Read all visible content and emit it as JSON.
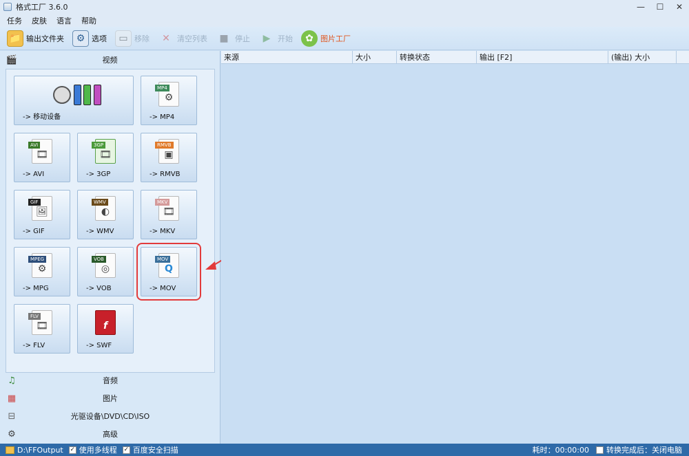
{
  "window": {
    "title": "格式工厂 3.6.0"
  },
  "menu": [
    "任务",
    "皮肤",
    "语言",
    "帮助"
  ],
  "toolbar": [
    {
      "label": "输出文件夹",
      "icon": "folder-icon",
      "disabled": false,
      "accent": false
    },
    {
      "label": "选项",
      "icon": "gear-icon",
      "disabled": false,
      "accent": false
    },
    {
      "label": "移除",
      "icon": "remove-icon",
      "disabled": true,
      "accent": false
    },
    {
      "label": "清空列表",
      "icon": "clear-list-icon",
      "disabled": true,
      "accent": false
    },
    {
      "label": "停止",
      "icon": "stop-icon",
      "disabled": true,
      "accent": false
    },
    {
      "label": "开始",
      "icon": "start-icon",
      "disabled": true,
      "accent": false
    },
    {
      "label": "图片工厂",
      "icon": "picture-factory-icon",
      "disabled": false,
      "accent": true
    }
  ],
  "left": {
    "video_section": "视频",
    "tiles": [
      {
        "label": "-> 移动设备",
        "tag": "",
        "name": "tile-mobile-device"
      },
      {
        "label": "-> MP4",
        "tag": "MP4",
        "name": "tile-mp4"
      },
      {
        "label": "-> AVI",
        "tag": "AVI",
        "name": "tile-avi"
      },
      {
        "label": "-> 3GP",
        "tag": "3GP",
        "name": "tile-3gp"
      },
      {
        "label": "-> RMVB",
        "tag": "RMVB",
        "name": "tile-rmvb"
      },
      {
        "label": "-> GIF",
        "tag": "GIF",
        "name": "tile-gif"
      },
      {
        "label": "-> WMV",
        "tag": "WMV",
        "name": "tile-wmv"
      },
      {
        "label": "-> MKV",
        "tag": "MKV",
        "name": "tile-mkv"
      },
      {
        "label": "-> MPG",
        "tag": "MPEG",
        "name": "tile-mpg"
      },
      {
        "label": "-> VOB",
        "tag": "VOB",
        "name": "tile-vob"
      },
      {
        "label": "-> MOV",
        "tag": "MOV",
        "name": "tile-mov",
        "highlighted": true
      },
      {
        "label": "-> FLV",
        "tag": "FLV",
        "name": "tile-flv"
      },
      {
        "label": "-> SWF",
        "tag": "SWF",
        "name": "tile-swf"
      }
    ],
    "sections": [
      "音频",
      "图片",
      "光驱设备\\DVD\\CD\\ISO",
      "高级"
    ]
  },
  "table": {
    "columns": [
      "来源",
      "大小",
      "转换状态",
      "输出 [F2]",
      "(输出) 大小"
    ]
  },
  "status": {
    "output_path": "D:\\FFOutput",
    "multithread_label": "使用多线程",
    "scan_label": "百度安全扫描",
    "elapsed": "耗时：00:00:00",
    "after_done": "转换完成后：关闭电脑"
  },
  "colors": {
    "highlight": "#e23b3b",
    "statusbar": "#2e6aa8",
    "accent": "#e0561f"
  }
}
